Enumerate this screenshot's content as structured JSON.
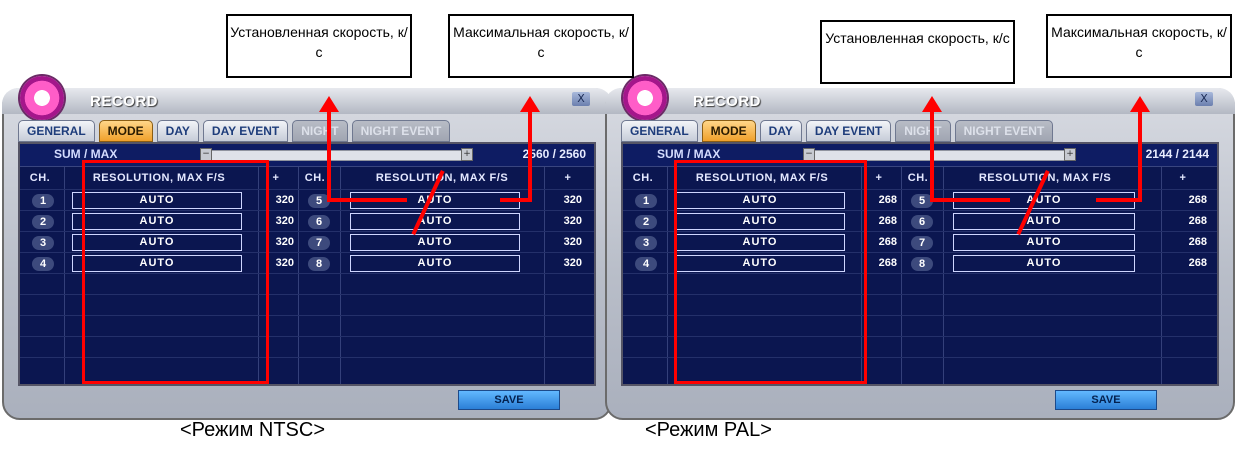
{
  "callouts": {
    "left_set": "Установленная скорость, к/с",
    "left_max": "Максимальная скорость, к/с",
    "right_set": "Установленная скорость, к/с",
    "right_max": "Максимальная скорость, к/с"
  },
  "panels": {
    "ntsc": {
      "title": "RECORD",
      "close": "X",
      "tabs": [
        "GENERAL",
        "MODE",
        "DAY",
        "DAY EVENT",
        "NIGHT",
        "NIGHT EVENT"
      ],
      "sum_label": "SUM / MAX",
      "sum_value": "2560 / 2560",
      "headers": {
        "ch": "CH.",
        "res": "RESOLUTION, MAX F/S",
        "plus": "+"
      },
      "rows_left": [
        {
          "ch": "1",
          "res": "AUTO",
          "fps": "320"
        },
        {
          "ch": "2",
          "res": "AUTO",
          "fps": "320"
        },
        {
          "ch": "3",
          "res": "AUTO",
          "fps": "320"
        },
        {
          "ch": "4",
          "res": "AUTO",
          "fps": "320"
        }
      ],
      "rows_right": [
        {
          "ch": "5",
          "res": "AUTO",
          "fps": "320"
        },
        {
          "ch": "6",
          "res": "AUTO",
          "fps": "320"
        },
        {
          "ch": "7",
          "res": "AUTO",
          "fps": "320"
        },
        {
          "ch": "8",
          "res": "AUTO",
          "fps": "320"
        }
      ],
      "save": "SAVE",
      "caption": "<Режим NTSC>"
    },
    "pal": {
      "title": "RECORD",
      "close": "X",
      "tabs": [
        "GENERAL",
        "MODE",
        "DAY",
        "DAY EVENT",
        "NIGHT",
        "NIGHT EVENT"
      ],
      "sum_label": "SUM / MAX",
      "sum_value": "2144 / 2144",
      "headers": {
        "ch": "CH.",
        "res": "RESOLUTION, MAX F/S",
        "plus": "+"
      },
      "rows_left": [
        {
          "ch": "1",
          "res": "AUTO",
          "fps": "268"
        },
        {
          "ch": "2",
          "res": "AUTO",
          "fps": "268"
        },
        {
          "ch": "3",
          "res": "AUTO",
          "fps": "268"
        },
        {
          "ch": "4",
          "res": "AUTO",
          "fps": "268"
        }
      ],
      "rows_right": [
        {
          "ch": "5",
          "res": "AUTO",
          "fps": "268"
        },
        {
          "ch": "6",
          "res": "AUTO",
          "fps": "268"
        },
        {
          "ch": "7",
          "res": "AUTO",
          "fps": "268"
        },
        {
          "ch": "8",
          "res": "AUTO",
          "fps": "268"
        }
      ],
      "save": "SAVE",
      "caption": "<Режим PAL>"
    }
  },
  "colors": {
    "screen_bg": "#0b1650",
    "active_tab": "#f0a02b",
    "annotation": "#ff0000",
    "save_button": "#2b7fd6"
  }
}
